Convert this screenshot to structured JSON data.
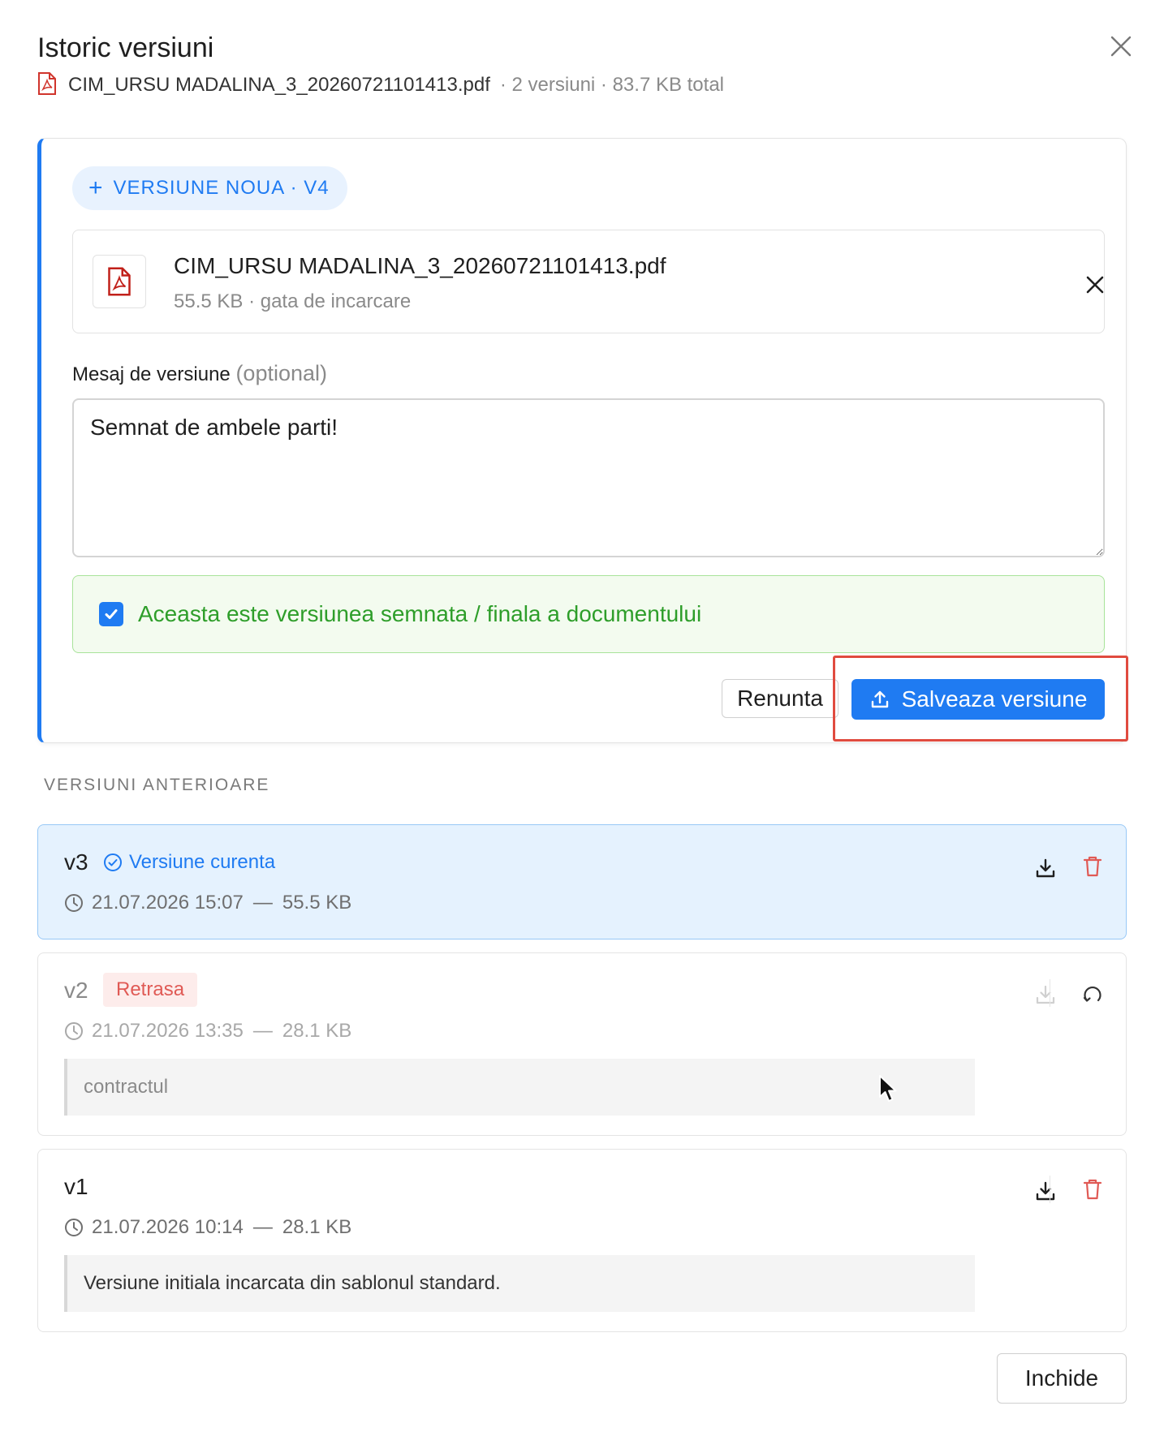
{
  "dialog": {
    "title": "Istoric versiuni",
    "file_name": "CIM_URSU MADALINA_3_20260721101413.pdf",
    "summary": "· 2 versiuni · 83.7 KB total"
  },
  "new_version": {
    "pill_label": "VERSIUNE NOUA · V4",
    "file": {
      "name": "CIM_URSU MADALINA_3_20260721101413.pdf",
      "status": "55.5 KB · gata de incarcare"
    },
    "message_label": "Mesaj de versiune",
    "message_optional": "(optional)",
    "message_value": "Semnat de ambele parti!",
    "final_checkbox": {
      "checked": true,
      "label": "Aceasta este versiunea semnata / finala a documentului"
    },
    "cancel_label": "Renunta",
    "save_label": "Salveaza versiune"
  },
  "previous": {
    "section_label": "VERSIUNI ANTERIOARE",
    "versions": [
      {
        "label": "v3",
        "badge": "Versiune curenta",
        "date": "21.07.2026 15:07",
        "dash": "—",
        "size": "55.5 KB"
      },
      {
        "label": "v2",
        "badge": "Retrasa",
        "date": "21.07.2026 13:35",
        "dash": "—",
        "size": "28.1 KB",
        "note": "contractul"
      },
      {
        "label": "v1",
        "date": "21.07.2026 10:14",
        "dash": "—",
        "size": "28.1 KB",
        "note": "Versiune initiala incarcata din sablonul standard."
      }
    ]
  },
  "footer": {
    "close_label": "Inchide"
  },
  "colors": {
    "accent": "#1f7bf2",
    "success": "#2e9e2a",
    "danger": "#e05a55",
    "highlight": "#e04b3f"
  },
  "icons": [
    "pdf-file-icon",
    "close-icon",
    "plus-icon",
    "upload-icon",
    "check-circle-icon",
    "clock-icon",
    "download-icon",
    "trash-icon",
    "restore-icon",
    "checkmark-icon",
    "mouse-cursor-icon"
  ]
}
